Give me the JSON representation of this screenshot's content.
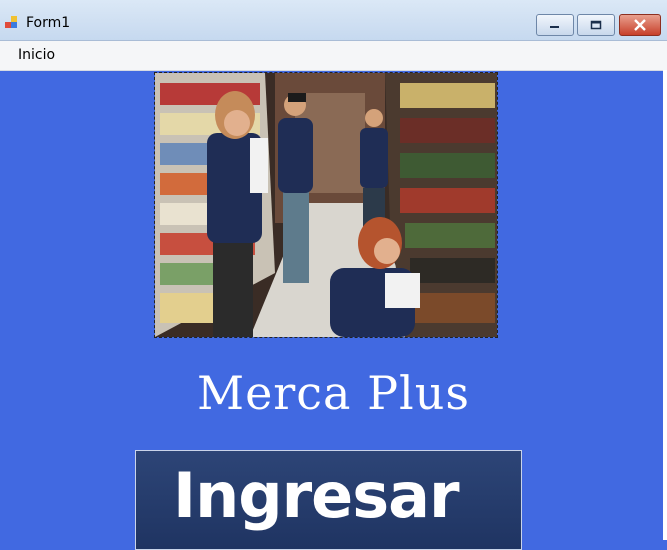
{
  "window": {
    "title": "Form1"
  },
  "menu": {
    "items": [
      "Inicio"
    ]
  },
  "main": {
    "brand_name": "Merca Plus",
    "login_button_label": "Ingresar",
    "photo_description_name": "supermarket-staff-photo"
  },
  "colors": {
    "background": "#4169E1",
    "brand_text": "#FFFFFF",
    "button_bg": "#253B6B"
  },
  "icons": [
    "app-form-icon",
    "minimize-icon",
    "maximize-icon",
    "close-icon"
  ]
}
